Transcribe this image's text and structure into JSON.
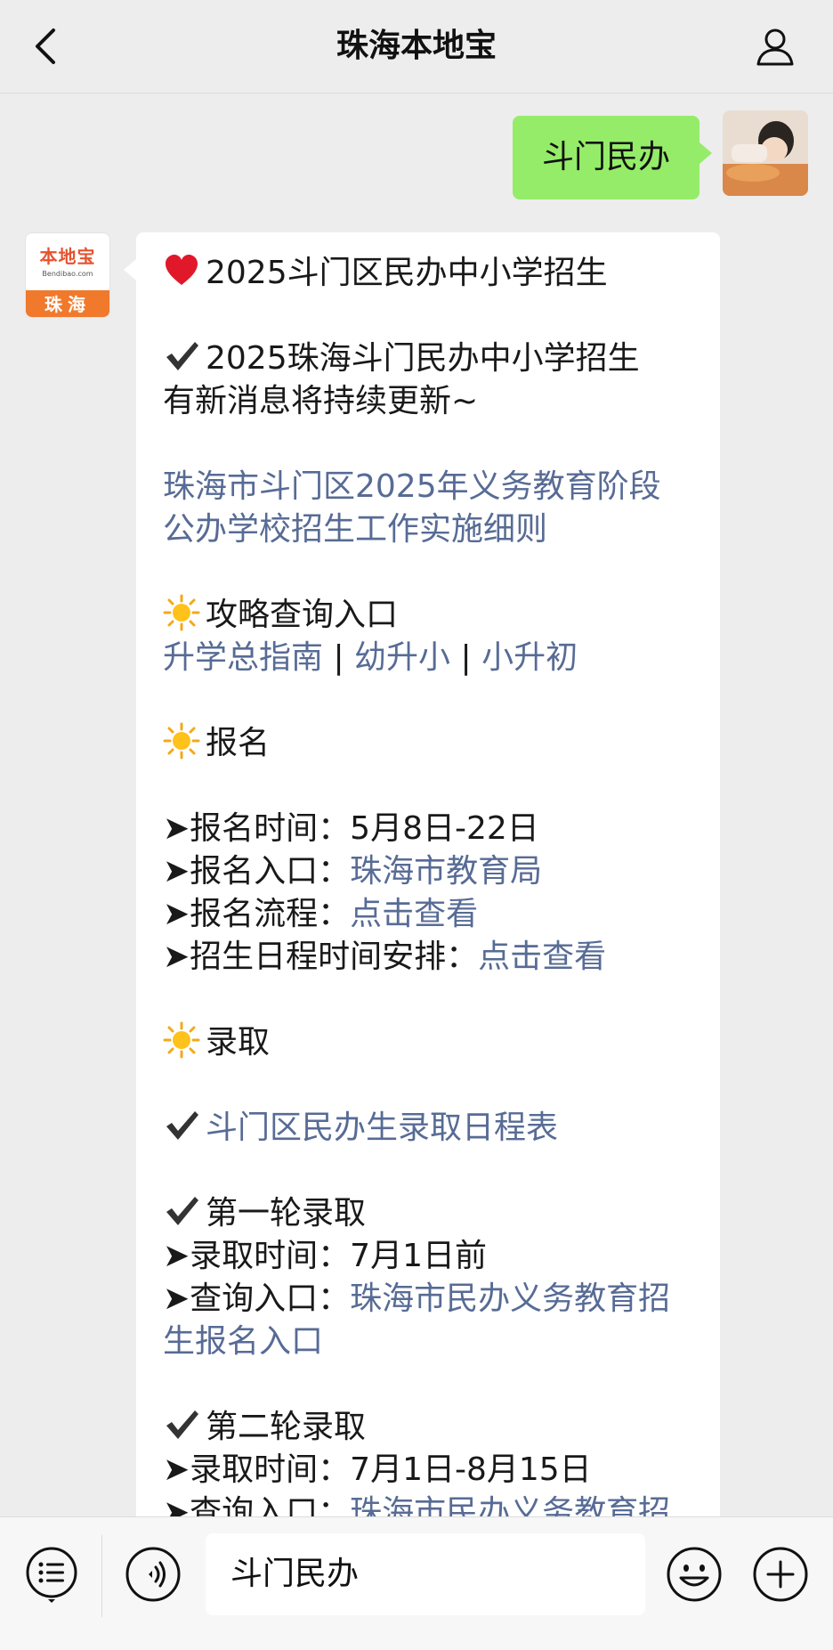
{
  "nav": {
    "title": "珠海本地宝"
  },
  "sent": {
    "text": "斗门民办"
  },
  "bot": {
    "logo_text": "本地宝",
    "logo_url": "Bendibao.com",
    "logo_city": "珠海"
  },
  "message": {
    "heading": "2025斗门区民办中小学招生",
    "intro_1": "2025珠海斗门民办中小学招生",
    "intro_2": "有新消息将持续更新~",
    "policy_link_1": "珠海市斗门区2025年义务教育阶段",
    "policy_link_2": "公办学校招生工作实施细则",
    "guide_title": "攻略查询入口",
    "guide_links": [
      "升学总指南",
      "幼升小",
      "小升初"
    ],
    "guide_sep": " | ",
    "signup_title": "报名",
    "signup_time_label": "➤报名时间：",
    "signup_time_value": "5月8日-22日",
    "signup_entry_label": "➤报名入口：",
    "signup_entry_link": "珠海市教育局",
    "signup_flow_label": "➤报名流程：",
    "signup_flow_link": "点击查看",
    "schedule_label": "➤招生日程时间安排：",
    "schedule_link": "点击查看",
    "admit_title": "录取",
    "admit_schedule_link": "斗门区民办生录取日程表",
    "round1_title": "第一轮录取",
    "round1_time_label": "➤录取时间：",
    "round1_time_value": "7月1日前",
    "round1_query_label": "➤查询入口：",
    "round1_query_link_1": "珠海市民办义务教育招",
    "round1_query_link_2": "生报名入口",
    "round2_title": "第二轮录取",
    "round2_time_label": "➤录取时间：",
    "round2_time_value": "7月1日-8月15日",
    "round2_query_label": "➤查询入口：",
    "round2_query_link": "珠海市民办义务教育招"
  },
  "input_bar": {
    "text": "斗门民办"
  },
  "icons": {
    "back": "chevron-left-icon",
    "user": "person-icon",
    "heart": "red-heart-icon",
    "check": "check-mark-icon",
    "sun": "sun-icon",
    "menu": "list-menu-icon",
    "voice": "voice-icon",
    "emoji": "smiley-icon",
    "plus": "plus-icon"
  },
  "colors": {
    "link": "#576b95",
    "sent_bubble": "#95ec69",
    "background": "#ededed",
    "brand_orange": "#f0792c"
  }
}
